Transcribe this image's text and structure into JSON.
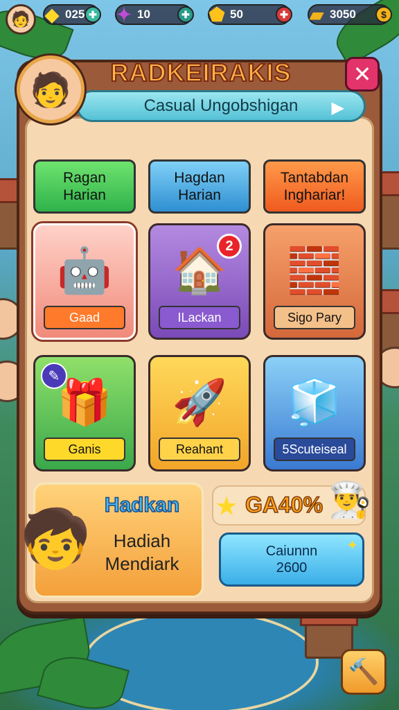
{
  "topbar": {
    "resources": [
      {
        "icon": "gem-icon",
        "value": "025",
        "plus_color": "#3ab8a0"
      },
      {
        "icon": "crystal-icon",
        "value": "10",
        "plus_color": "#2a9a8a"
      },
      {
        "icon": "shield-coin-icon",
        "value": "50",
        "plus_color": "#d83a3a"
      },
      {
        "icon": "gold-bar-icon",
        "value": "3050",
        "plus_color": "#f2b21a"
      }
    ]
  },
  "header": {
    "title": "RADKEIRAKIS",
    "subtitle": "Casual Ungobshigan"
  },
  "tabs": [
    {
      "label": "Ragan Harian"
    },
    {
      "label": "Hagdan Harian"
    },
    {
      "label": "Tantabdan Inghariar!"
    }
  ],
  "items": [
    {
      "label": "Gaad",
      "icon": "robot-toy-icon"
    },
    {
      "label": "ILackan",
      "icon": "shop-house-icon",
      "badge": "2"
    },
    {
      "label": "Sigo Pary",
      "icon": "blocks-icon"
    },
    {
      "label": "Ganis",
      "icon": "gift-box-icon"
    },
    {
      "label": "Reahant",
      "icon": "rocket-icon"
    },
    {
      "label": "5Scuteiseal",
      "icon": "cubes-icon"
    }
  ],
  "promo": {
    "title": "Hadkan",
    "desc_line1": "Hadiah",
    "desc_line2": "Mendiark"
  },
  "reward": {
    "value": "GA40%",
    "button_line1": "Caiunnn",
    "button_line2": "2600"
  },
  "colors": {
    "accent": "#ffb347",
    "close": "#e2346a",
    "panel": "#9b5a3a"
  }
}
